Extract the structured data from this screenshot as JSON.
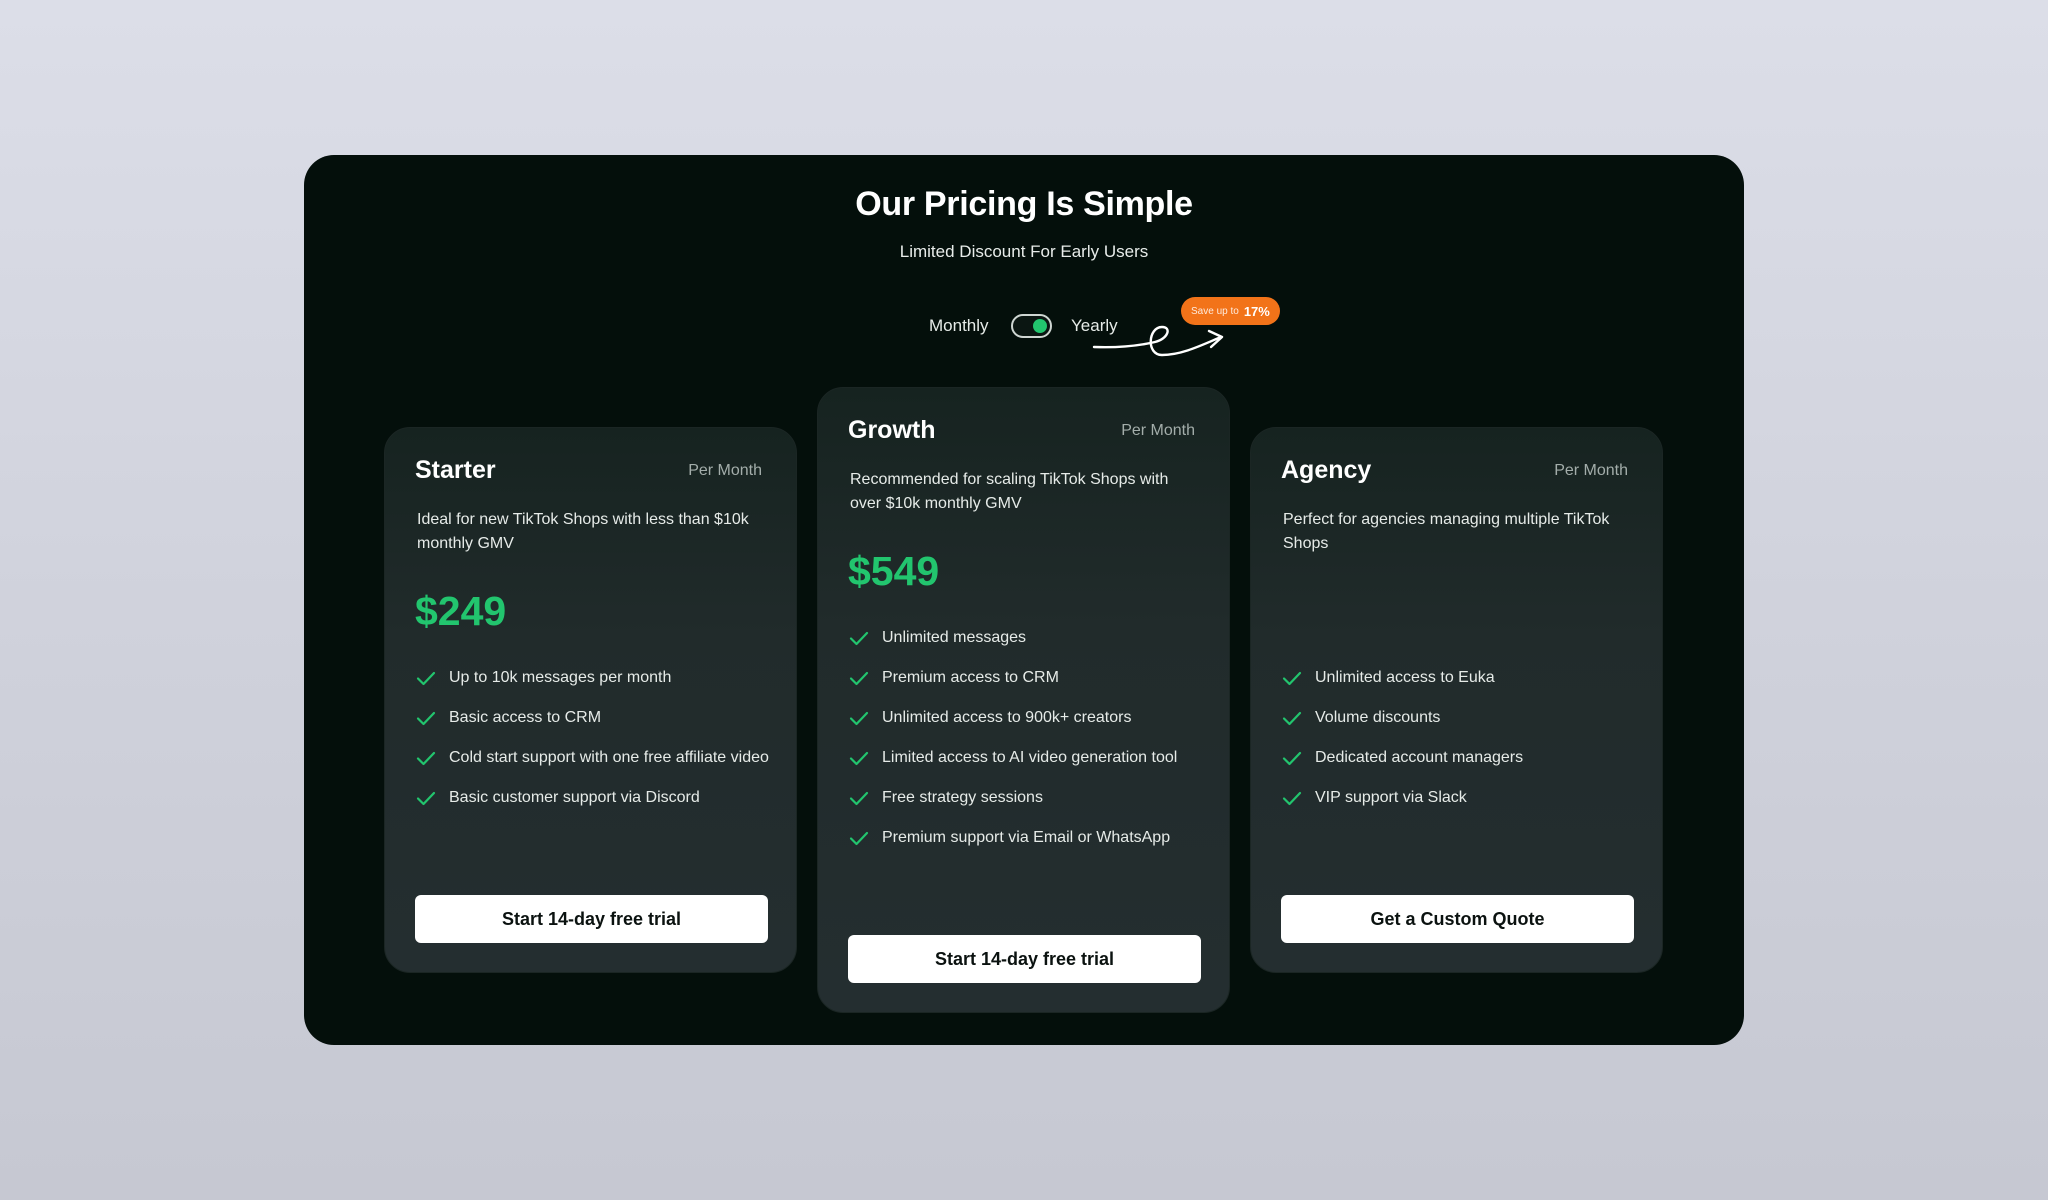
{
  "header": {
    "title": "Our Pricing Is Simple",
    "subtitle": "Limited Discount For Early Users"
  },
  "billing": {
    "monthly_label": "Monthly",
    "yearly_label": "Yearly",
    "selected": "Yearly",
    "save_badge_prefix": "Save up to",
    "save_badge_value": "17%"
  },
  "plans": [
    {
      "name": "Starter",
      "period": "Per Month",
      "description": "Ideal for new TikTok Shops with less than $10k monthly GMV",
      "price": "$249",
      "features": [
        "Up to 10k messages per month",
        "Basic access to CRM",
        "Cold start support with one free affiliate video",
        "Basic customer support via Discord"
      ],
      "cta": "Start 14-day free trial"
    },
    {
      "name": "Growth",
      "period": "Per Month",
      "description": "Recommended for scaling TikTok Shops with over $10k monthly GMV",
      "price": "$549",
      "features": [
        "Unlimited messages",
        "Premium access to CRM",
        "Unlimited access to 900k+ creators",
        "Limited access to AI video generation tool",
        "Free strategy sessions",
        "Premium support via Email or WhatsApp"
      ],
      "cta": "Start 14-day free trial"
    },
    {
      "name": "Agency",
      "period": "Per Month",
      "description": "Perfect for agencies managing multiple TikTok Shops",
      "price": "",
      "features": [
        "Unlimited access to Euka",
        "Volume discounts",
        "Dedicated account managers",
        "VIP support via Slack"
      ],
      "cta": "Get a Custom Quote"
    }
  ],
  "colors": {
    "accent_green": "#22c56e",
    "badge_orange": "#f27319",
    "panel_bg": "#040f0b"
  },
  "icons": {
    "feature": "check-icon",
    "decoration": "curly-arrow-icon"
  }
}
